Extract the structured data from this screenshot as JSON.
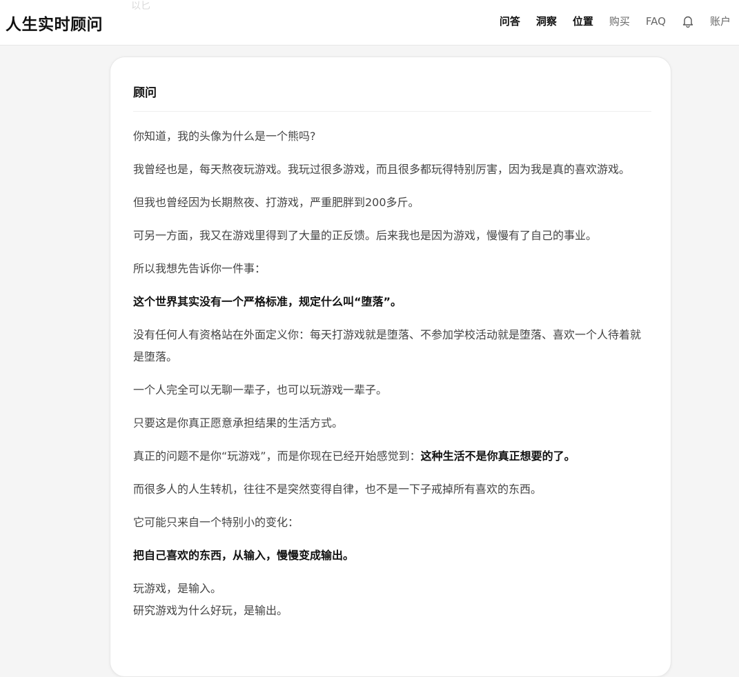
{
  "header": {
    "brand": "人生实时顾问",
    "ghost_text": "以匕",
    "nav": {
      "qa": "问答",
      "insight": "洞察",
      "location": "位置",
      "buy": "购买",
      "faq": "FAQ",
      "bell_icon": "bell-icon",
      "account": "账户"
    }
  },
  "card": {
    "title": "顾问",
    "paragraphs": {
      "p1": "你知道，我的头像为什么是一个熊吗?",
      "p2": "我曾经也是，每天熬夜玩游戏。我玩过很多游戏，而且很多都玩得特别厉害，因为我是真的喜欢游戏。",
      "p3": "但我也曾经因为长期熬夜、打游戏，严重肥胖到200多斤。",
      "p4": "可另一方面，我又在游戏里得到了大量的正反馈。后来我也是因为游戏，慢慢有了自己的事业。",
      "p5": "所以我想先告诉你一件事：",
      "p6": "这个世界其实没有一个严格标准，规定什么叫“堕落”。",
      "p7": "没有任何人有资格站在外面定义你：每天打游戏就是堕落、不参加学校活动就是堕落、喜欢一个人待着就是堕落。",
      "p8": "一个人完全可以无聊一辈子，也可以玩游戏一辈子。",
      "p9": "只要这是你真正愿意承担结果的生活方式。",
      "p10_plain": "真正的问题不是你“玩游戏”，而是你现在已经开始感觉到：",
      "p10_bold": "这种生活不是你真正想要的了。",
      "p11": "而很多人的人生转机，往往不是突然变得自律，也不是一下子戒掉所有喜欢的东西。",
      "p12": "它可能只来自一个特别小的变化：",
      "p13": "把自己喜欢的东西，从输入，慢慢变成输出。",
      "p14_line1": "玩游戏，是输入。",
      "p14_line2": "研究游戏为什么好玩，是输出。"
    }
  }
}
